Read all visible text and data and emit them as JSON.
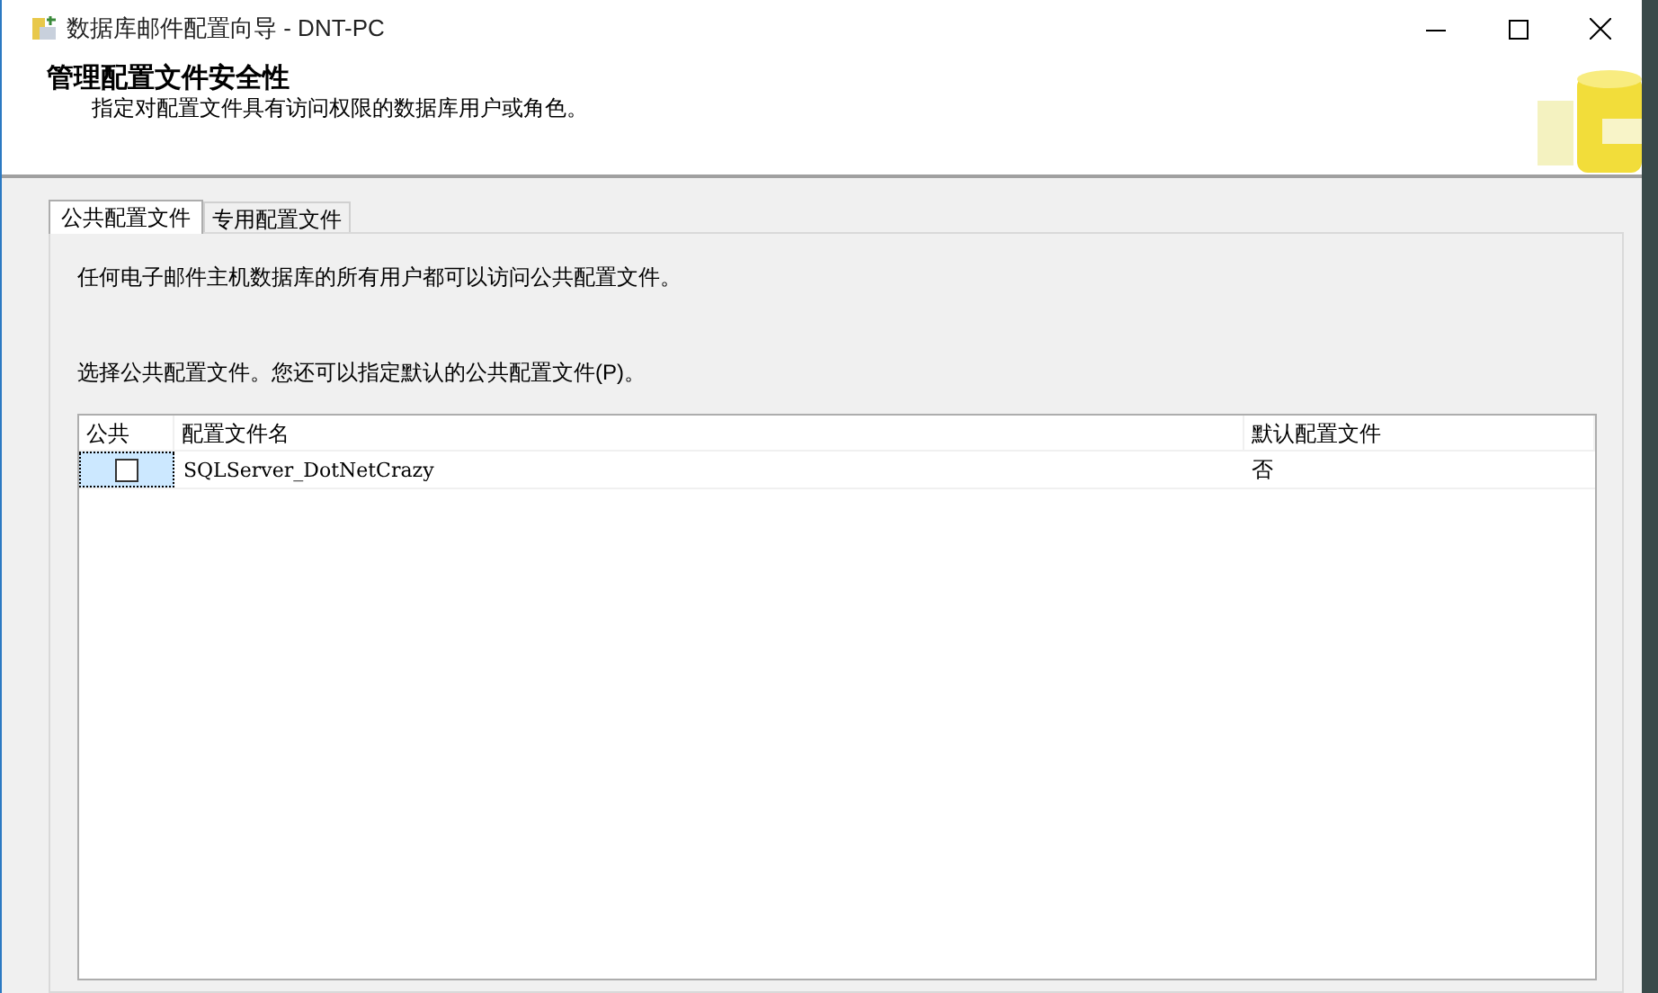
{
  "window": {
    "title": "数据库邮件配置向导 - DNT-PC"
  },
  "header": {
    "title": "管理配置文件安全性",
    "subtitle": "指定对配置文件具有访问权限的数据库用户或角色。"
  },
  "tabs": [
    {
      "label": "公共配置文件",
      "selected": true
    },
    {
      "label": "专用配置文件",
      "selected": false
    }
  ],
  "intro": "任何电子邮件主机数据库的所有用户都可以访问公共配置文件。",
  "instruction": "选择公共配置文件。您还可以指定默认的公共配置文件(P)。",
  "table": {
    "columns": [
      "公共",
      "配置文件名",
      "默认配置文件"
    ],
    "rows": [
      {
        "checked": false,
        "selected": true,
        "name": "SQLServer_DotNetCrazy",
        "default": "否"
      }
    ]
  }
}
